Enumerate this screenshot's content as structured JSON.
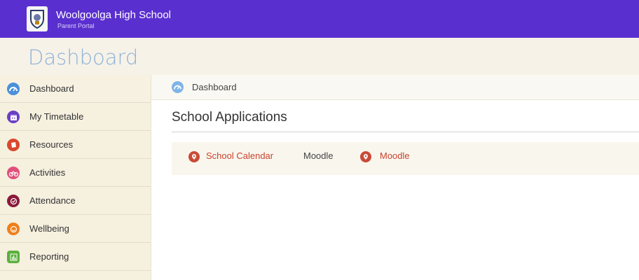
{
  "header": {
    "school_name": "Woolgoolga High School",
    "portal_name": "Parent Portal",
    "logo_icon": "school-crest-icon",
    "bg_color": "#5a2fcf"
  },
  "page": {
    "title": "Dashboard"
  },
  "sidebar": {
    "items": [
      {
        "label": "Dashboard",
        "icon": "dashboard-icon",
        "color": "#4a90d9"
      },
      {
        "label": "My Timetable",
        "icon": "calendar-icon",
        "color": "#6b3fc4"
      },
      {
        "label": "Resources",
        "icon": "book-icon",
        "color": "#d9482e"
      },
      {
        "label": "Activities",
        "icon": "bicycle-icon",
        "color": "#e0507a"
      },
      {
        "label": "Attendance",
        "icon": "check-icon",
        "color": "#8a1a3a"
      },
      {
        "label": "Wellbeing",
        "icon": "smile-icon",
        "color": "#f07f1a"
      },
      {
        "label": "Reporting",
        "icon": "bar-chart-icon",
        "color": "#5cb03c"
      }
    ]
  },
  "breadcrumb": {
    "label": "Dashboard",
    "icon": "dashboard-icon"
  },
  "main": {
    "section_title": "School Applications",
    "apps": [
      {
        "label": "School Calendar",
        "icon": "link-icon"
      },
      {
        "label": "Moodle"
      },
      {
        "label": "Moodle",
        "icon": "link-icon"
      }
    ]
  }
}
